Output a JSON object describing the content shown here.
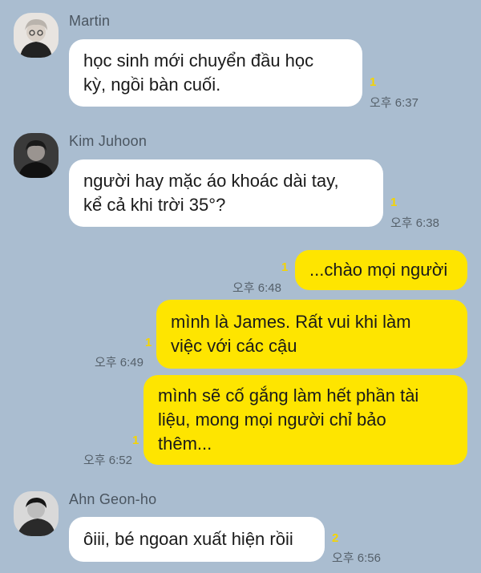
{
  "colors": {
    "background": "#aabdd0",
    "incoming_bubble": "#ffffff",
    "outgoing_bubble": "#fee500",
    "unread_count": "#f5d400"
  },
  "messages": [
    {
      "sender": "Martin",
      "avatar": "martin-avatar",
      "text": "học sinh mới chuyển đầu học\nkỳ, ngồi bàn cuối.",
      "unread": "1",
      "time": "오후 6:37"
    },
    {
      "sender": "Kim Juhoon",
      "avatar": "kim-juhoon-avatar",
      "text": "người hay mặc áo khoác dài tay,\nkể cả khi trời 35°?",
      "unread": "1",
      "time": "오후 6:38"
    },
    {
      "sender": "",
      "text": "...chào mọi người",
      "unread": "1",
      "time": "오후 6:48"
    },
    {
      "sender": "",
      "text": "mình là James. Rất vui khi làm\nviệc với các cậu",
      "unread": "1",
      "time": "오후 6:49"
    },
    {
      "sender": "",
      "text": "mình sẽ cố gắng làm hết phần tài\nliệu, mong mọi người chỉ bảo\nthêm...",
      "unread": "1",
      "time": "오후 6:52"
    },
    {
      "sender": "Ahn Geon-ho",
      "avatar": "ahn-geon-ho-avatar",
      "text": "ôiii, bé ngoan xuất hiện rồii",
      "unread": "2",
      "time": "오후 6:56"
    }
  ]
}
